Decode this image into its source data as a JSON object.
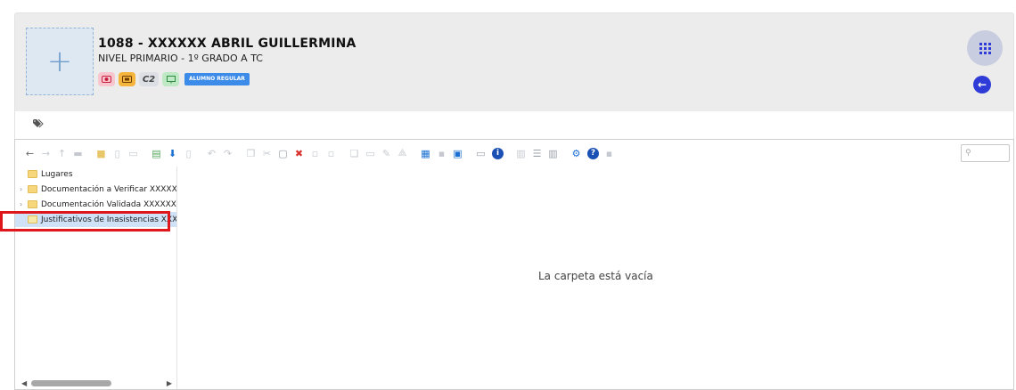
{
  "student": {
    "name": "1088 - XXXXXX ABRIL GUILLERMINA",
    "level": "NIVEL PRIMARIO - 1º GRADO A TC",
    "badges": {
      "c2": "C2",
      "status": "ALUMNO REGULAR"
    }
  },
  "colors": {
    "accent": "#2f3bd6",
    "pill": "#3d8be8",
    "highlight": "#e0161d"
  },
  "file_manager": {
    "tree": [
      {
        "label": "Lugares",
        "has_children": false
      },
      {
        "label": "Documentación a Verificar XXXXXX",
        "has_children": true
      },
      {
        "label": "Documentación Validada XXXXXX A",
        "has_children": true
      },
      {
        "label": "Justificativos de Inasistencias XXXXX",
        "has_children": false,
        "selected": true
      }
    ],
    "empty_message": "La carpeta está vacía",
    "search_placeholder": ""
  }
}
